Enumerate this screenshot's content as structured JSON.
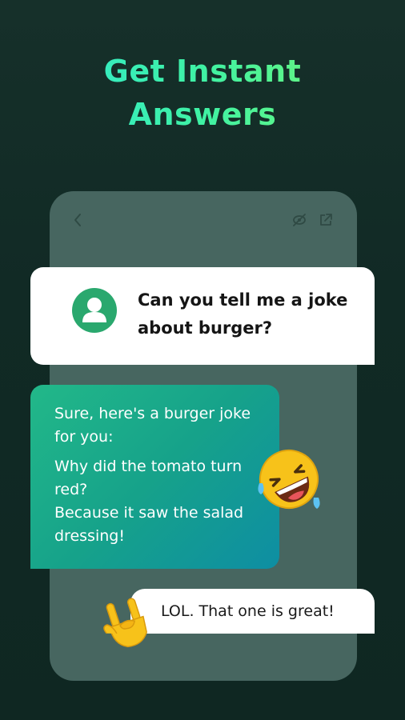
{
  "headline": {
    "line1": "Get Instant",
    "line2": "Answers"
  },
  "phone": {
    "icons": [
      "chevron-left-icon",
      "eye-off-icon",
      "share-icon"
    ]
  },
  "question": {
    "avatar_icon": "user-icon",
    "text": "Can you tell me a joke about burger?"
  },
  "answer": {
    "paragraph1": "Sure, here's a burger joke for you:",
    "paragraph2_line1": "Why did the tomato turn red?",
    "paragraph2_line2": "Because it saw the salad dressing!",
    "emoji": "rolling-on-floor-laughing-emoji"
  },
  "reply": {
    "text": "LOL. That one is great!",
    "emoji": "sign-of-the-horns-emoji"
  },
  "colors": {
    "background": "#112a25",
    "headline_gradient_start": "#2ee6d6",
    "headline_gradient_end": "#7df76c",
    "phone": "#476660",
    "avatar": "#2aa86e",
    "answer_gradient_start": "#22b889",
    "answer_gradient_end": "#0e8ea3"
  }
}
